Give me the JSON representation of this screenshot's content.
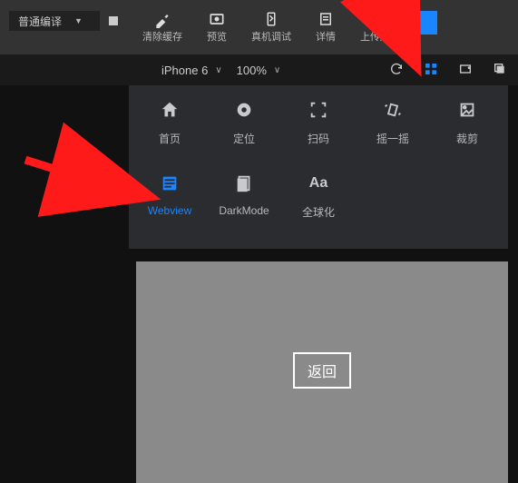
{
  "topbar": {
    "compile_mode": "普通编译",
    "tools": {
      "clear_cache": "清除缓存",
      "preview": "预览",
      "device_debug": "真机调试",
      "details": "详情",
      "upload": "上传版本"
    }
  },
  "subbar": {
    "device": "iPhone 6",
    "zoom": "100%"
  },
  "panel": {
    "items": [
      {
        "label": "首页"
      },
      {
        "label": "定位"
      },
      {
        "label": "扫码"
      },
      {
        "label": "摇一摇"
      },
      {
        "label": "裁剪"
      },
      {
        "label": "Webview"
      },
      {
        "label": "DarkMode"
      },
      {
        "label": "全球化"
      }
    ]
  },
  "viewport": {
    "back_label": "返回"
  }
}
